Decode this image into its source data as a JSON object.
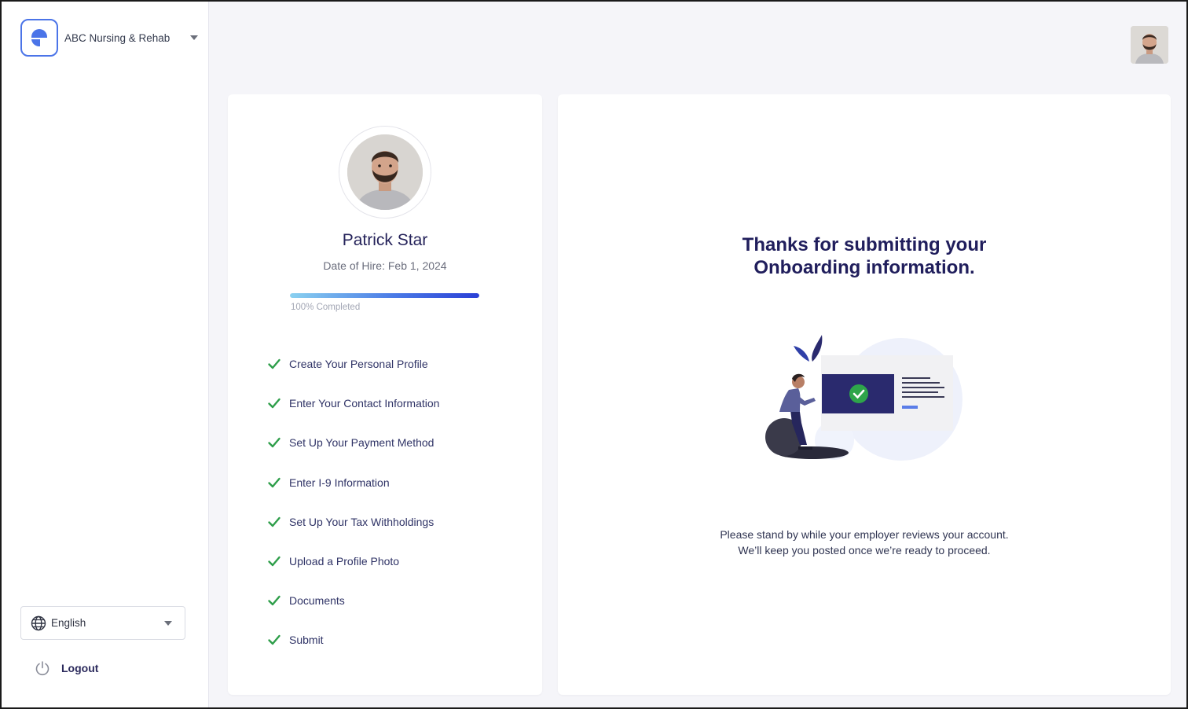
{
  "sidebar": {
    "org_name": "ABC Nursing & Rehab",
    "language": "English",
    "logout_label": "Logout"
  },
  "profile": {
    "name": "Patrick Star",
    "hire_date": "Date of Hire: Feb 1, 2024",
    "progress_percent": 100,
    "progress_label": "100% Completed",
    "steps": [
      {
        "label": "Create Your Personal Profile",
        "status": "complete"
      },
      {
        "label": "Enter Your Contact Information",
        "status": "complete"
      },
      {
        "label": "Set Up Your Payment Method",
        "status": "complete"
      },
      {
        "label": "Enter I-9 Information",
        "status": "complete"
      },
      {
        "label": "Set Up Your Tax Withholdings",
        "status": "complete"
      },
      {
        "label": "Upload a Profile Photo",
        "status": "complete"
      },
      {
        "label": "Documents",
        "status": "complete"
      },
      {
        "label": "Submit",
        "status": "complete"
      }
    ]
  },
  "result": {
    "title_line1": "Thanks for submitting your",
    "title_line2": "Onboarding information.",
    "message_line1": "Please stand by while your employer reviews your account.",
    "message_line2": "We’ll keep you posted once we’re ready to proceed."
  },
  "colors": {
    "accent": "#4b74e8",
    "check": "#2e9e4a",
    "title": "#201e5c",
    "background": "#f5f5f9"
  },
  "icons": {
    "logo": "brand-logo-icon",
    "caret": "chevron-down-icon",
    "globe": "globe-icon",
    "power": "power-icon",
    "check": "check-icon"
  }
}
